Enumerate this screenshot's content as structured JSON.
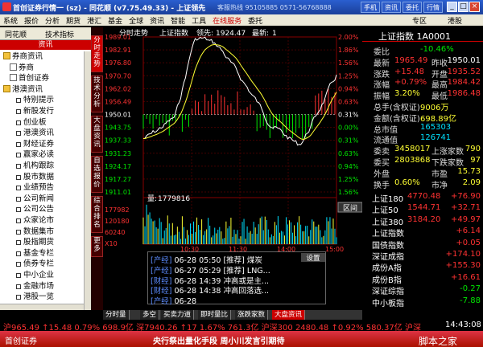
{
  "window": {
    "title": "首创证券行情一 (sz) - 同花顺 (v7.75.49.33) - 上证领先",
    "hotline": "客服热线 95105885 0571-56768888",
    "buttons": [
      "手机",
      "资讯",
      "委托",
      "行情"
    ],
    "right_buttons": [
      "专区",
      "港股"
    ]
  },
  "menu": [
    "系统",
    "报价",
    "分析",
    "期货",
    "港汇",
    "基金",
    "全球",
    "资讯",
    "智能",
    "工具",
    "在线服务",
    "委托"
  ],
  "sidebar": {
    "tabs": [
      "同花顺",
      "技术指标"
    ],
    "header": "资讯",
    "tree": [
      {
        "label": "券商资讯",
        "kind": "folder",
        "indent": 0
      },
      {
        "label": "券商",
        "kind": "page",
        "indent": 1
      },
      {
        "label": "首创证券",
        "kind": "page",
        "indent": 1
      },
      {
        "label": "港澳资讯",
        "kind": "folder",
        "indent": 0
      },
      {
        "label": "特别提示",
        "kind": "sq",
        "indent": 2
      },
      {
        "label": "新股发行",
        "kind": "sq",
        "indent": 2
      },
      {
        "label": "创业板",
        "kind": "sq",
        "indent": 2
      },
      {
        "label": "港澳资讯",
        "kind": "sq",
        "indent": 2
      },
      {
        "label": "财经证券",
        "kind": "sq",
        "indent": 2
      },
      {
        "label": "赢家必读",
        "kind": "sq",
        "indent": 2
      },
      {
        "label": "机构跟踪",
        "kind": "sq",
        "indent": 2
      },
      {
        "label": "股市数据",
        "kind": "sq",
        "indent": 2
      },
      {
        "label": "业绩预告",
        "kind": "sq",
        "indent": 2
      },
      {
        "label": "公司新闻",
        "kind": "sq",
        "indent": 2
      },
      {
        "label": "公司公告",
        "kind": "sq",
        "indent": 2
      },
      {
        "label": "众家论市",
        "kind": "sq",
        "indent": 2
      },
      {
        "label": "数据集市",
        "kind": "sq",
        "indent": 2
      },
      {
        "label": "股指期货",
        "kind": "sq",
        "indent": 2
      },
      {
        "label": "基金专栏",
        "kind": "sq",
        "indent": 2
      },
      {
        "label": "债券专栏",
        "kind": "sq",
        "indent": 2
      },
      {
        "label": "中小企业",
        "kind": "sq",
        "indent": 2
      },
      {
        "label": "金融市场",
        "kind": "sq",
        "indent": 2
      },
      {
        "label": "港股一览",
        "kind": "sq",
        "indent": 2
      }
    ]
  },
  "vtabs": [
    "分时走势",
    "技术分析",
    "大盘资讯",
    "自选报价",
    "综合排名",
    "更多"
  ],
  "chart": {
    "title": "分时走势",
    "index_name": "上证指数",
    "lead_label": "领先:",
    "lead_value": "1924.47",
    "latest_label": "最新:",
    "latest_value": "1",
    "volume_label": "量:",
    "volume_value": "1779816",
    "left_ticks": [
      "1989.01",
      "1982.91",
      "1976.80",
      "1970.70",
      "1962.02",
      "1956.49",
      "1950.01",
      "1943.75",
      "1937.33",
      "1931.23",
      "1924.17",
      "1917.27",
      "1911.01"
    ],
    "right_ticks": [
      "2.00%",
      "1.86%",
      "1.56%",
      "1.25%",
      "0.94%",
      "0.63%",
      "0.31%",
      "0.00%",
      "0.31%",
      "0.63%",
      "0.94%",
      "1.25%",
      "1.56%"
    ],
    "vol_ticks": [
      "177982",
      "120180",
      "60240",
      "X10"
    ],
    "time_ticks": [
      "10:30",
      "11:30",
      "14:00",
      "15:00"
    ],
    "chart_button": "区间"
  },
  "news": {
    "settings": "设置",
    "items": [
      {
        "tag": "[产经]",
        "date": "06-28",
        "time": "05:50",
        "kind": "[推荐]",
        "text": "煤炭"
      },
      {
        "tag": "[产经]",
        "date": "06-27",
        "time": "05:29",
        "kind": "[推荐]",
        "text": "LNG..."
      },
      {
        "tag": "[财经]",
        "date": "06-28",
        "time": "14:39",
        "kind": "",
        "text": "冲高或是主..."
      },
      {
        "tag": "[财经]",
        "date": "06-28",
        "time": "14:38",
        "kind": "",
        "text": "冲高回落选..."
      },
      {
        "tag": "[产经]",
        "date": "06-28",
        "time": "",
        "kind": "",
        "text": ""
      }
    ]
  },
  "bottom_tabs": [
    "分时量",
    "多空",
    "买卖力道",
    "即时量比",
    "涨跌家数",
    "大盘资讯"
  ],
  "right": {
    "title": "上证指数 1A0001",
    "rows": [
      {
        "l": "委比",
        "v": "-10.46%",
        "c": "green"
      },
      {
        "l": "最新",
        "v": "1965.49",
        "c": "red",
        "l2": "昨收",
        "v2": "1950.01"
      },
      {
        "l": "涨跌",
        "v": "+15.48",
        "c": "red",
        "l2": "开盘",
        "v2": "1935.52"
      },
      {
        "l": "涨幅",
        "v": "+0.79%",
        "c": "red",
        "l2": "最高",
        "v2": "1984.42"
      },
      {
        "l": "振幅",
        "v": "3.20%",
        "c": "yellow",
        "l2": "最低",
        "v2": "1986.48"
      },
      {
        "l": "总手(含权证)",
        "v": "9006万",
        "c": "yellow"
      },
      {
        "l": "金额(含权证)",
        "v": "698.89亿",
        "c": "yellow"
      },
      {
        "l": "总市值",
        "v": "165303",
        "c": "cyan"
      },
      {
        "l": "流通值",
        "v": "126741",
        "c": "cyan"
      },
      {
        "l": "委卖",
        "v": "3458017",
        "c": "yellow",
        "l2": "上涨家数",
        "v2": "790"
      },
      {
        "l": "委买",
        "v": "2803868",
        "c": "yellow",
        "l2": "下跌家数",
        "v2": "97"
      },
      {
        "l": "外盘",
        "v": "",
        "c": "yellow",
        "l2": "市盈",
        "v2": "15.73"
      },
      {
        "l": "换手",
        "v": "0.60%",
        "c": "yellow",
        "l2": "市净",
        "v2": "2.09"
      }
    ],
    "indices": [
      {
        "n": "上证180",
        "p": "4770.48",
        "c": "+76.90"
      },
      {
        "n": "上证50",
        "p": "1544.71",
        "c": "+32.71"
      },
      {
        "n": "上证380",
        "p": "3184.20",
        "c": "+49.97"
      },
      {
        "n": "上证指数",
        "p": "",
        "c": "+6.14"
      },
      {
        "n": "国债指数",
        "p": "",
        "c": "+0.05"
      },
      {
        "n": "深证成指",
        "p": "",
        "c": "+174.10"
      },
      {
        "n": "成份A指",
        "p": "",
        "c": "+155.30"
      },
      {
        "n": "成份B指",
        "p": "",
        "c": "+16.61"
      },
      {
        "n": "深证综指",
        "p": "",
        "c": "-0.27"
      },
      {
        "n": "中小板指",
        "p": "",
        "c": "-7.88"
      }
    ]
  },
  "ticker": {
    "text": "沪965.49 ↑15.48 0.79% 698.9亿 深7940.26 ↑17 1.67% 761.3亿 沪深300 2480.48 ↑0.92% 580.37亿 沪深",
    "time": "14:43:08"
  },
  "status": {
    "left": "首创证券",
    "middle": "央行祭出量化手段   周小川发言引期待",
    "watermark": "脚本之家"
  }
}
